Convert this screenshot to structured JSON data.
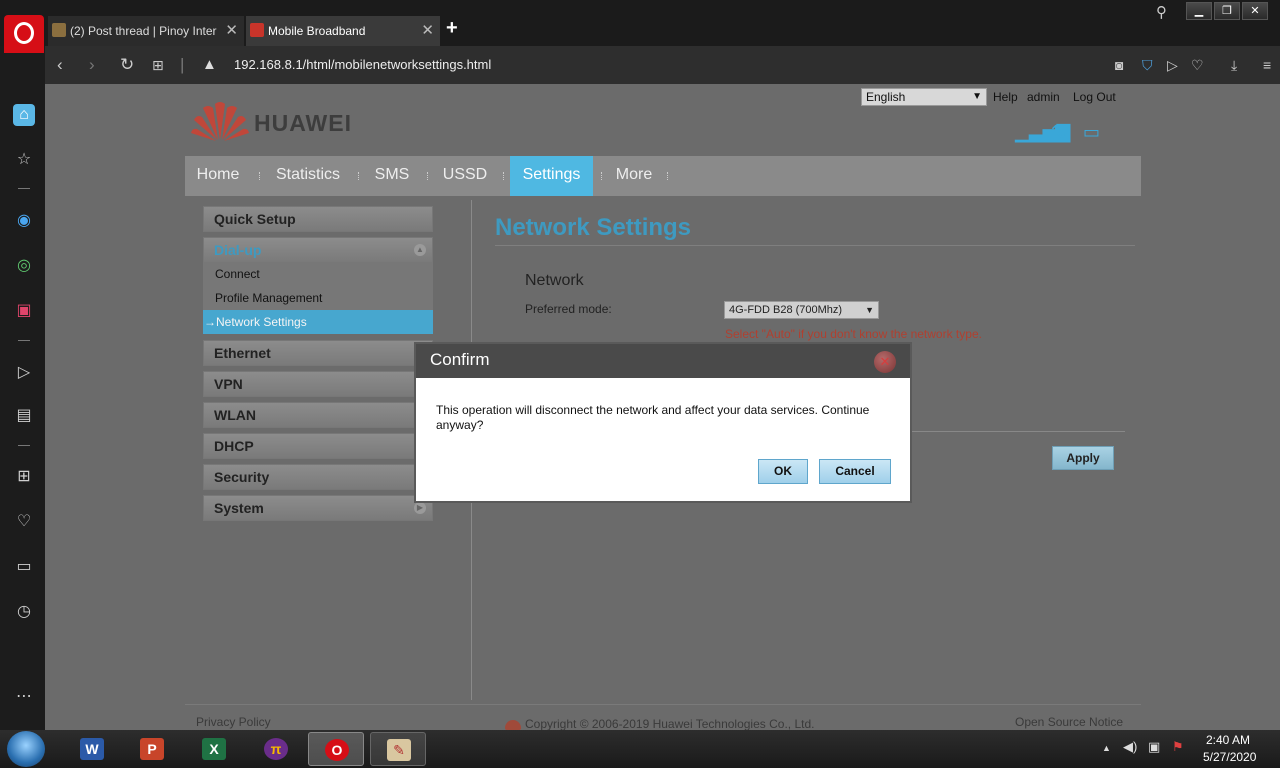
{
  "browser": {
    "tabs": [
      {
        "title": "(2) Post thread | Pinoy Inter",
        "active": false
      },
      {
        "title": "Mobile Broadband",
        "active": true
      }
    ],
    "new_tab_icon": "plus-icon",
    "url": "192.168.8.1/html/mobilenetworksettings.html",
    "window_controls": {
      "minimize": "▁",
      "maximize": "❐",
      "close": "✕"
    }
  },
  "header": {
    "language": "English",
    "links": [
      "Help",
      "admin",
      "Log Out"
    ],
    "brand": "HUAWEI"
  },
  "nav": [
    "Home",
    "Statistics",
    "SMS",
    "USSD",
    "Settings",
    "More"
  ],
  "nav_active": "Settings",
  "left_menu": {
    "quick_setup": "Quick Setup",
    "dialup": "Dial-up",
    "dialup_items": [
      "Connect",
      "Profile Management",
      "→Network Settings"
    ],
    "sections": [
      "Ethernet",
      "VPN",
      "WLAN",
      "DHCP",
      "Security",
      "System"
    ]
  },
  "content": {
    "title": "Network Settings",
    "section": "Network",
    "preferred_mode_label": "Preferred mode:",
    "preferred_mode_value": "4G-FDD B28 (700Mhz)",
    "hint": "Select \"Auto\" if you don't know the network type.",
    "apply": "Apply"
  },
  "footer": {
    "privacy": "Privacy Policy",
    "copyright": "Copyright © 2006-2019 Huawei Technologies Co., Ltd.",
    "open_source": "Open Source Notice"
  },
  "dialog": {
    "title": "Confirm",
    "message": "This operation will disconnect the network and affect your data services. Continue anyway?",
    "ok": "OK",
    "cancel": "Cancel"
  },
  "taskbar": {
    "time": "2:40 AM",
    "date": "5/27/2020"
  },
  "colors": {
    "accent": "#4fb8e2",
    "title": "#3e9ac1",
    "hint": "#b04030",
    "opera_red": "#d60e16"
  }
}
